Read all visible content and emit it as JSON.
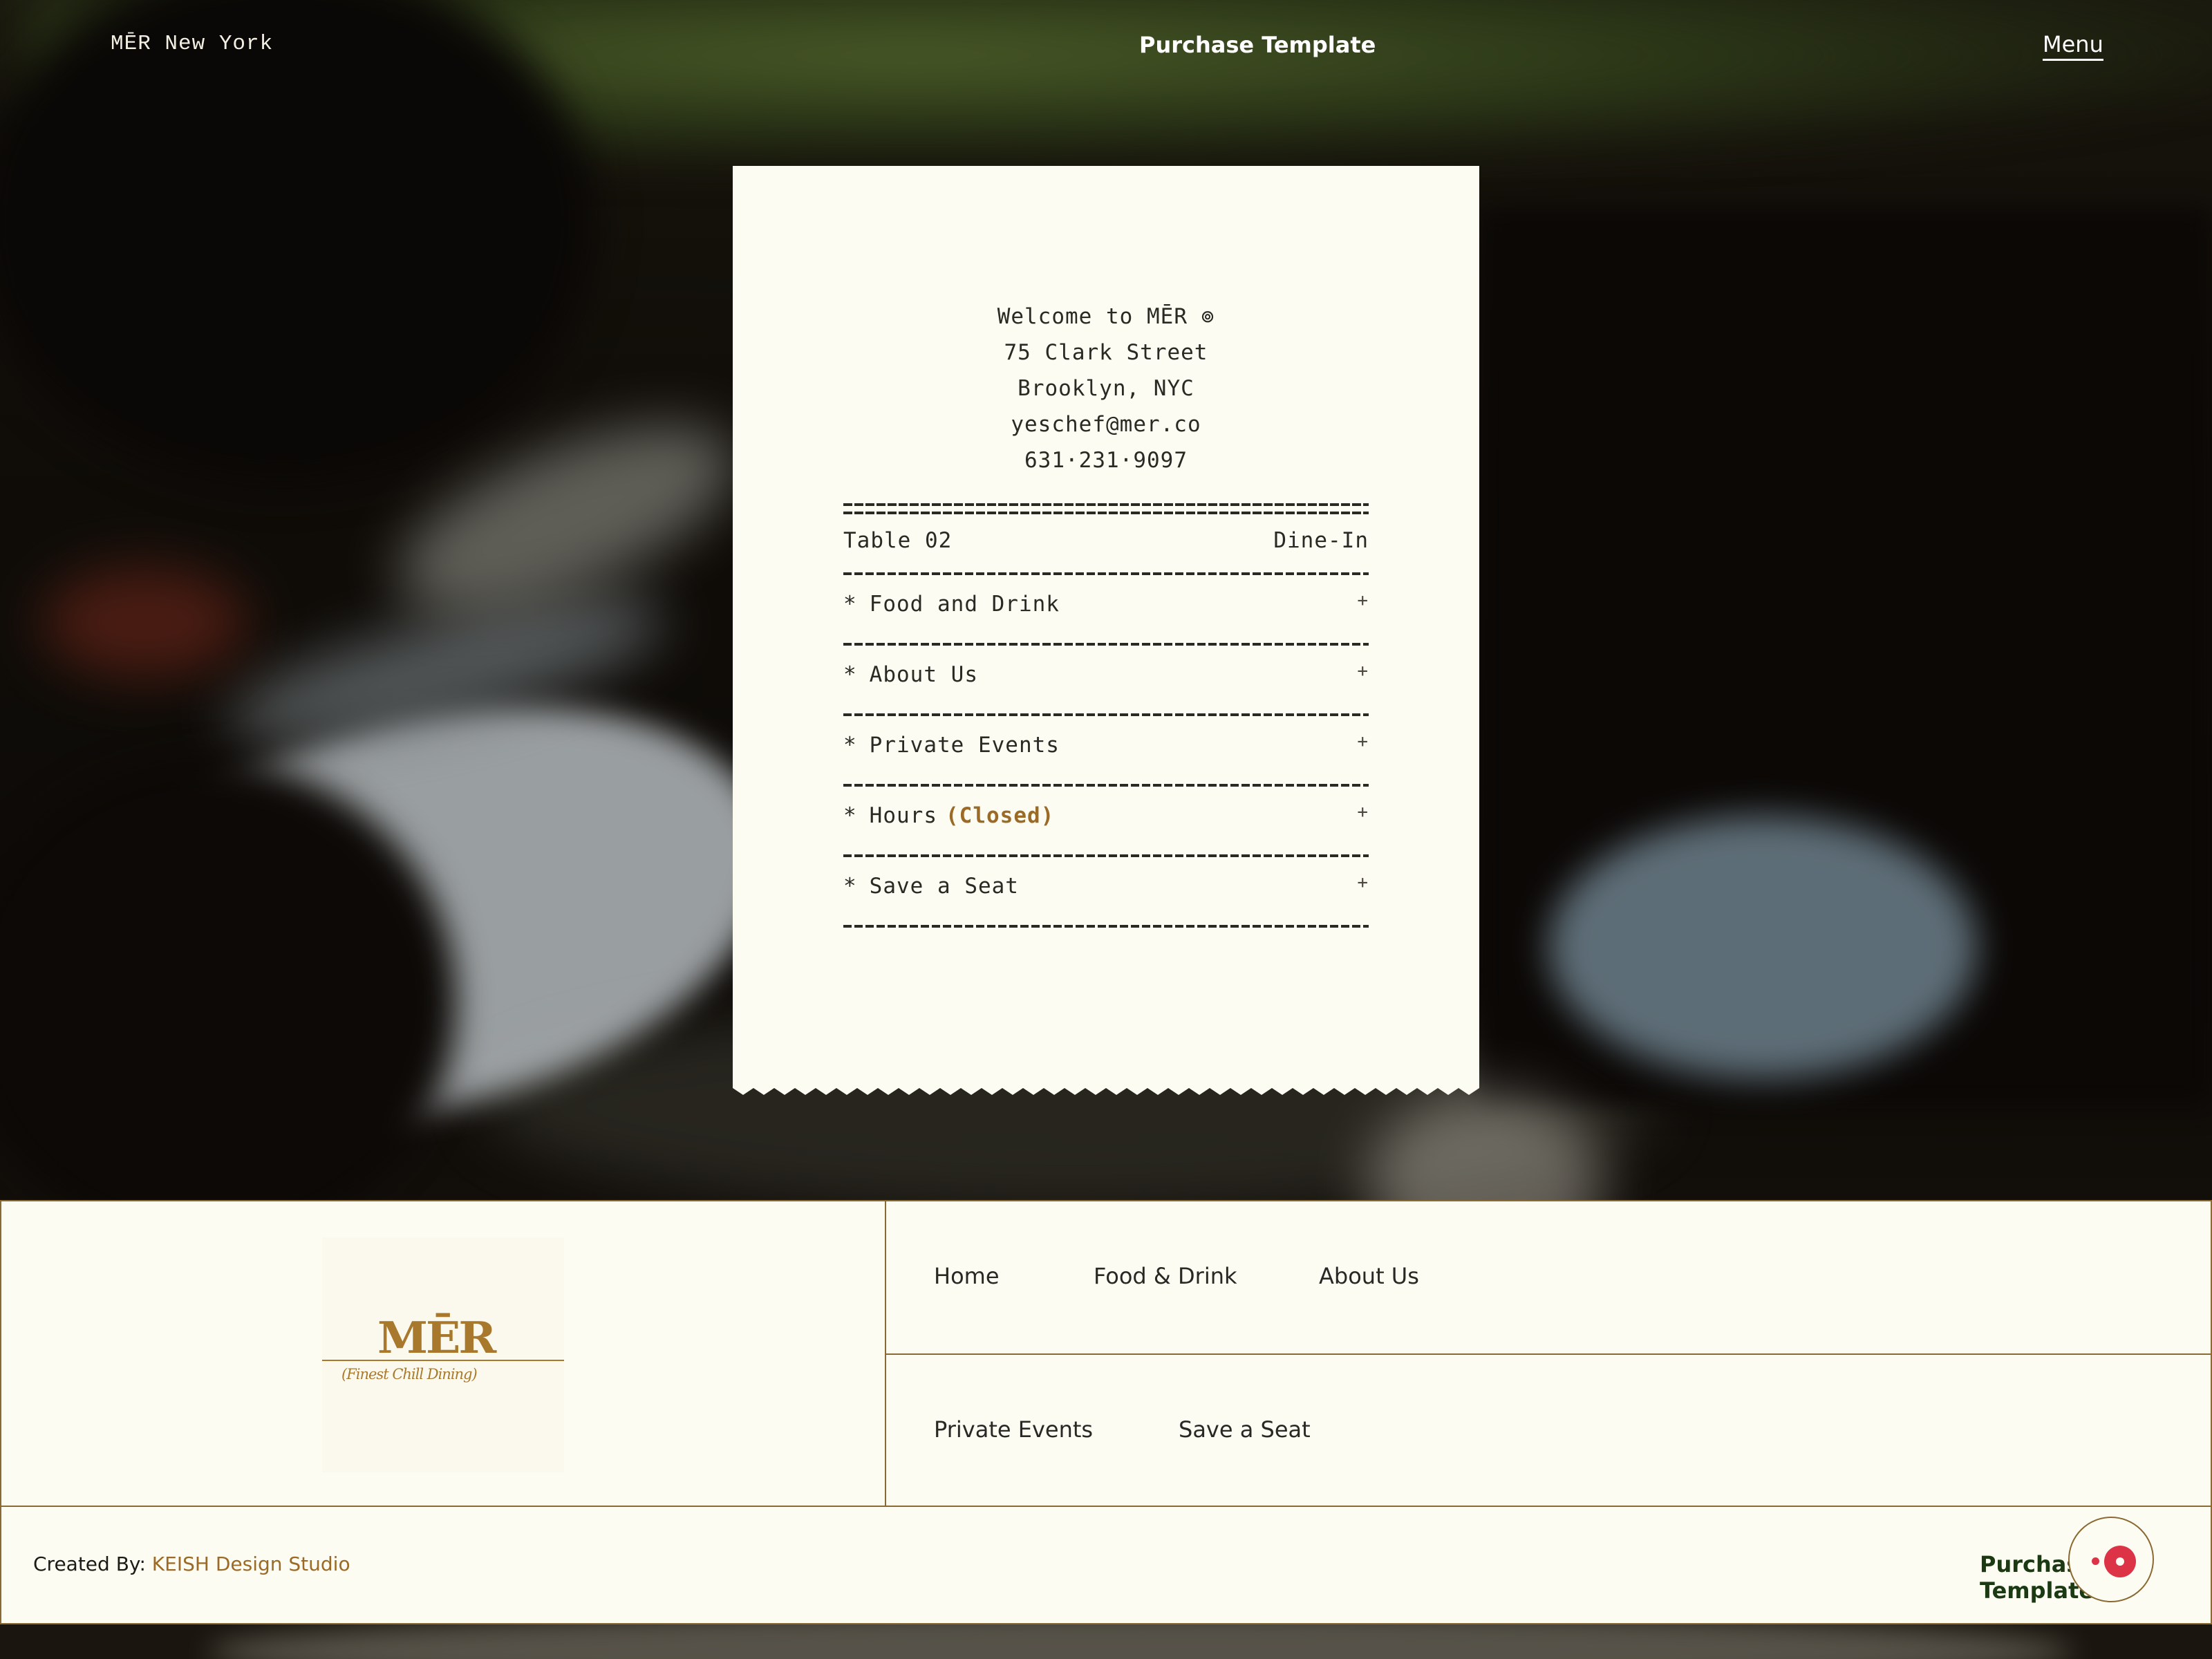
{
  "header": {
    "brand": "MĒR New York",
    "purchase_label": "Purchase Template",
    "menu_label": "Menu"
  },
  "receipt": {
    "address_lines": [
      "Welcome to MĒR ⊚",
      "75 Clark Street",
      "Brooklyn, NYC",
      "yeschef@mer.co",
      "631·231·9097"
    ],
    "table_label": "Table 02",
    "service_label": "Dine-In",
    "items": [
      {
        "label": "Food and Drink",
        "status": ""
      },
      {
        "label": "About Us",
        "status": ""
      },
      {
        "label": "Private Events",
        "status": ""
      },
      {
        "label": "Hours",
        "status": "(Closed)"
      },
      {
        "label": "Save a Seat",
        "status": ""
      }
    ],
    "bullet": "*",
    "expand_symbol": "+"
  },
  "logo": {
    "wordmark": "MĒR",
    "tagline": "(Finest Chill Dining)"
  },
  "footer_nav": {
    "home": "Home",
    "food_drink": "Food & Drink",
    "about_us": "About Us",
    "private_events": "Private Events",
    "save_seat": "Save a Seat"
  },
  "credit": {
    "prefix": "Created By:",
    "studio": "KEISH Design Studio"
  },
  "bottom_purchase": "Purchase Template",
  "colors": {
    "accent": "#9a6a26",
    "paper": "#fdfcf3",
    "border": "#8a6a32",
    "fab_red": "#dd3346",
    "purchase_green": "#1b3a14"
  },
  "icons": {
    "fab": "record-icon",
    "expand": "plus-icon"
  }
}
